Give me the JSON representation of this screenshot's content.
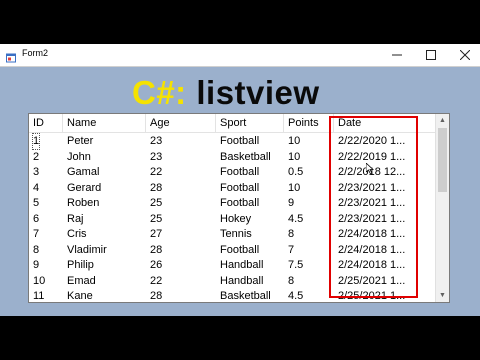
{
  "window": {
    "title": "Form2"
  },
  "heading": {
    "left": "C#:",
    "right": "listview"
  },
  "listview": {
    "columns": [
      "ID",
      "Name",
      "Age",
      "Sport",
      "Points",
      "Date"
    ],
    "rows": [
      [
        "1",
        "Peter",
        "23",
        "Football",
        "10",
        "2/22/2020 1..."
      ],
      [
        "2",
        "John",
        "23",
        "Basketball",
        "10",
        "2/22/2019 1..."
      ],
      [
        "3",
        "Gamal",
        "22",
        "Football",
        "0.5",
        "2/2/2018 12..."
      ],
      [
        "4",
        "Gerard",
        "28",
        "Football",
        "10",
        "2/23/2021 1..."
      ],
      [
        "5",
        "Roben",
        "25",
        "Football",
        "9",
        "2/23/2021 1..."
      ],
      [
        "6",
        "Raj",
        "25",
        "Hokey",
        "4.5",
        "2/23/2021 1..."
      ],
      [
        "7",
        "Cris",
        "27",
        "Tennis",
        "8",
        "2/24/2018 1..."
      ],
      [
        "8",
        "Vladimir",
        "28",
        "Football",
        "7",
        "2/24/2018 1..."
      ],
      [
        "9",
        "Philip",
        "26",
        "Handball",
        "7.5",
        "2/24/2018 1..."
      ],
      [
        "10",
        "Emad",
        "22",
        "Handball",
        "8",
        "2/25/2021 1..."
      ],
      [
        "11",
        "Kane",
        "28",
        "Basketball",
        "4.5",
        "2/25/2021 1..."
      ]
    ]
  },
  "highlight": {
    "column": "Date",
    "color": "#e00000"
  },
  "colors": {
    "form_bg": "#9bb0cc",
    "heading_left": "#f5e200",
    "heading_right": "#0a0a0a"
  }
}
